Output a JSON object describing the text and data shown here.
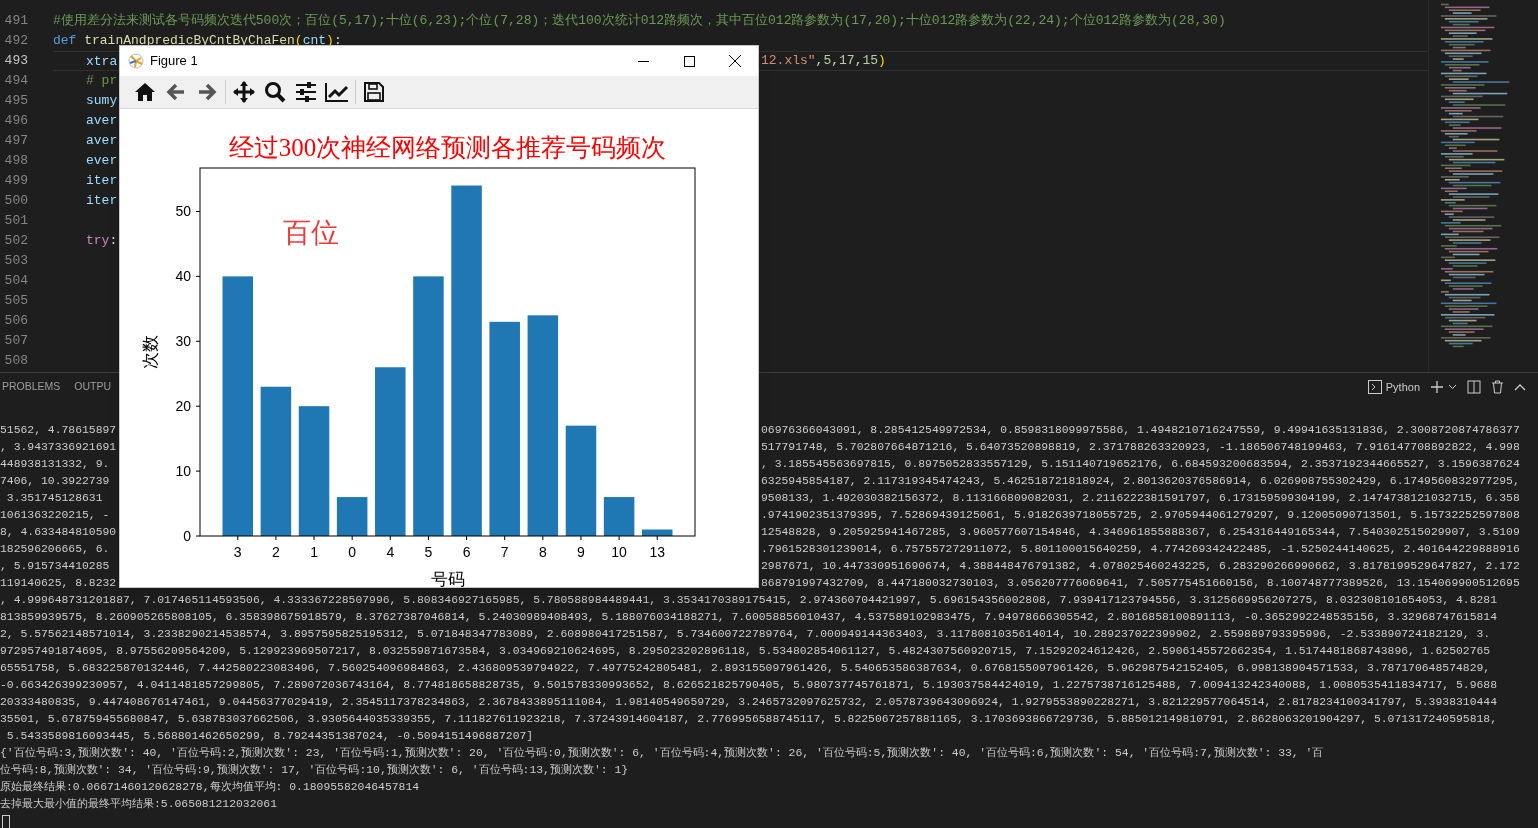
{
  "editor": {
    "lines": [
      {
        "number": "491",
        "current": false,
        "tokens": [
          {
            "text": "#使用差分法来测试各号码频次迭代500次；百位(5,17);十位(6,23);个位(7,28)；迭代100次统计012路频次，其中百位012路参数为(17,20);十位012路参数为(22,24);个位012路参数为(28,30)",
            "kind": "comment"
          }
        ]
      },
      {
        "number": "492",
        "current": false,
        "tokens": [
          {
            "text": "def ",
            "kind": "keyword"
          },
          {
            "text": "trainAndpredicByCntByChaFen",
            "kind": "function"
          },
          {
            "text": "(",
            "kind": "bracket"
          },
          {
            "text": "cnt",
            "kind": "variable"
          },
          {
            "text": ")",
            "kind": "bracket"
          },
          {
            "text": ":",
            "kind": "punct"
          }
        ],
        "children": [
          {
            "number": "493",
            "current": true,
            "tokens": [
              {
                "text": "xtra",
                "kind": "variable"
              }
            ],
            "tail": [
              {
                "text": "12.xls\"",
                "kind": "string"
              },
              {
                "text": ",",
                "kind": "punct"
              },
              {
                "text": "5",
                "kind": "number"
              },
              {
                "text": ",",
                "kind": "punct"
              },
              {
                "text": "17",
                "kind": "number"
              },
              {
                "text": ",",
                "kind": "punct"
              },
              {
                "text": "15",
                "kind": "number"
              },
              {
                "text": ")",
                "kind": "bracket"
              }
            ]
          },
          {
            "number": "494",
            "current": false,
            "tokens": [
              {
                "text": "# pr",
                "kind": "comment"
              }
            ]
          },
          {
            "number": "495",
            "current": false,
            "tokens": [
              {
                "text": "sumy",
                "kind": "variable"
              }
            ]
          },
          {
            "number": "496",
            "current": false,
            "tokens": [
              {
                "text": "aver",
                "kind": "variable"
              }
            ]
          },
          {
            "number": "497",
            "current": false,
            "tokens": [
              {
                "text": "aver",
                "kind": "variable"
              }
            ]
          },
          {
            "number": "498",
            "current": false,
            "tokens": [
              {
                "text": "ever",
                "kind": "variable"
              }
            ]
          },
          {
            "number": "499",
            "current": false,
            "tokens": [
              {
                "text": "iter",
                "kind": "variable"
              }
            ]
          },
          {
            "number": "500",
            "current": false,
            "tokens": [
              {
                "text": "iter",
                "kind": "variable"
              }
            ]
          },
          {
            "number": "501",
            "current": false
          },
          {
            "number": "502",
            "current": false,
            "tokens": [
              {
                "text": "try",
                "kind": "control"
              },
              {
                "text": ":",
                "kind": "punct"
              }
            ],
            "children": [
              {
                "number": "503",
                "current": false
              },
              {
                "number": "504",
                "current": false
              },
              {
                "number": "505",
                "current": false
              },
              {
                "number": "506",
                "current": false
              },
              {
                "number": "507",
                "current": false
              },
              {
                "number": "508",
                "current": false
              }
            ]
          }
        ]
      }
    ]
  },
  "panel": {
    "tabs": [
      {
        "label": "PROBLEMS",
        "selected": false
      },
      {
        "label": "OUTPU",
        "selected": false
      }
    ],
    "terminal_name": "Python"
  },
  "terminal": {
    "lines": [
      {
        "text": "51562, 4.78615897",
        "right": "06976366043091, 8.285412549972534, 0.8598318099975586, 1.4948210716247559, 9.49941635131836, 2.3008720874786377"
      },
      {
        "text": ", 3.9437336921691",
        "right": "517791748, 5.702807664871216, 5.64073520898819, 2.371788263320923, -1.186506748199463, 7.916147708892822, 4.998"
      },
      {
        "text": "448938131332, 9.",
        "right": ", 3.185545563697815, 0.8975052833557129, 5.151140719652176, 6.684593200683594, 2.3537192344665527, 3.1596387624"
      },
      {
        "text": "7406, 10.3922739",
        "right": "6325945854187, 2.117319345474243, 5.462518721818924, 2.8013620376586914, 6.026908755302429, 6.1749560832977295,"
      },
      {
        "text": " 3.351745128631",
        "right": "9508133, 1.492030382156372, 8.113166809082031, 2.2116222381591797, 6.173159599304199, 2.1474738121032715, 6.358"
      },
      {
        "text": "1061363220215, -",
        "right": ".9741902351379395, 7.52869439125061, 5.9182639718055725, 2.9705944061279297, 9.12005090713501, 5.15732252597808"
      },
      {
        "text": "8, 4.633484810590",
        "right": "12548828, 9.205925941467285, 3.960577607154846, 4.346961855888367, 6.254316449165344, 7.540302515029907, 3.5109"
      },
      {
        "text": "182596206665, 6.",
        "right": ".7961528301239014, 6.757557272911072, 5.801100015640259, 4.774269342422485, -1.5250244140625, 2.401644229888916"
      },
      {
        "text": ", 5.915734410285",
        "right": "2987671, 10.447330951690674, 4.388448476791382, 4.078025460243225, 6.283290266990662, 3.8178199529647827, 2.172"
      },
      {
        "text": "119140625, 8.8232",
        "right": "868791997432709, 8.447180032730103, 3.056207776069641, 7.505775451660156, 8.100748777389526, 13.154069900512695"
      },
      {
        "text": ", 4.999648731201887, 7.017465114593506, 4.333367228507996, 5.808346927165985, 5.780588984489441, 3.3534170389175415, 2.974360704421997, 5.696154356002808, 7.939417123794556, 3.3125669956207275, 8.032308101654053, 4.8281"
      },
      {
        "text": "813859939575, 8.260905265808105, 6.358398675918579, 8.37627387046814, 5.24030989408493, 5.188076034188271, 7.60058856010437, 4.537589102983475, 7.94978666305542, 2.8016858100891113, -0.3652992248535156, 3.32968747615814"
      },
      {
        "text": "2, 5.57562148571014, 3.2338290214538574, 3.8957595825195312, 5.071848347783089, 2.608980417251587, 5.734600722789764, 7.000949144363403, 3.1178081035614014, 10.289237022399902, 2.559889793395996, -2.533890724182129, 3."
      },
      {
        "text": "972957491874695, 8.97556209564209, 5.129923969507217, 8.032559871673584, 3.034969210624695, 8.295023202896118, 5.534802854061127, 5.4824307560920715, 7.15292024612426, 2.5906145572662354, 1.5174481868743896, 1.62502765"
      },
      {
        "text": "65551758, 5.683225870132446, 7.442580223083496, 7.560254096984863, 2.436809539794922, 7.49775242805481, 2.893155097961426, 5.540653586387634, 0.6768155097961426, 5.962987542152405, 6.998138904571533, 3.787170648574829,"
      },
      {
        "text": "-0.663426399230957, 4.0411481857299805, 7.289072036743164, 8.774818658828735, 9.501578330993652, 8.626521825790405, 5.980737745761871, 5.193037584424019, 1.2275738716125488, 7.009413242340088, 1.0080535411834717, 5.9688"
      },
      {
        "text": "20333480835, 9.447408676147461, 9.04456377029419, 2.3545117378234863, 2.3678433895111084, 1.98140549659729, 3.2465732097625732, 2.0578739643096924, 1.9279553890228271, 3.821229577064514, 2.8178234100341797, 5.3938310444"
      },
      {
        "text": "35501, 5.678759455680847, 5.638783037662506, 3.9305644035339355, 7.111827611923218, 7.37243914604187, 2.7769956588745117, 5.8225067257881165, 3.1703693866729736, 5.885012149810791, 2.8628063201904297, 5.071317240595818,"
      },
      {
        "text": " 5.5433589816093445, 5.568801462650299, 8.79244351387024, -0.5094151496887207]"
      },
      {
        "text": "{'百位号码:3,预测次数': 40, '百位号码:2,预测次数': 23, '百位号码:1,预测次数': 20, '百位号码:0,预测次数': 6, '百位号码:4,预测次数': 26, '百位号码:5,预测次数': 40, '百位号码:6,预测次数': 54, '百位号码:7,预测次数': 33, '百"
      },
      {
        "text": "位号码:8,预测次数': 34, '百位号码:9,预测次数': 17, '百位号码:10,预测次数': 6, '百位号码:13,预测次数': 1}"
      },
      {
        "text": "原始最终结果:0.06671460120628278,每次均值平均: 0.18095582046457814"
      },
      {
        "text": "去掉最大最小值的最终平均结果:5.065081212032061"
      }
    ]
  },
  "figure": {
    "title": "Figure 1",
    "chart_data": {
      "type": "bar",
      "title": "经过300次神经网络预测各推荐号码频次",
      "xlabel": "号码",
      "ylabel": "次数",
      "categories": [
        "3",
        "2",
        "1",
        "0",
        "4",
        "5",
        "6",
        "7",
        "8",
        "9",
        "10",
        "13"
      ],
      "values": [
        40,
        23,
        20,
        6,
        26,
        40,
        54,
        33,
        34,
        17,
        6,
        1
      ],
      "ylim": [
        0,
        56.7
      ],
      "yticks": [
        0,
        10,
        20,
        30,
        40,
        50
      ],
      "annotations": [
        "百位"
      ]
    }
  }
}
